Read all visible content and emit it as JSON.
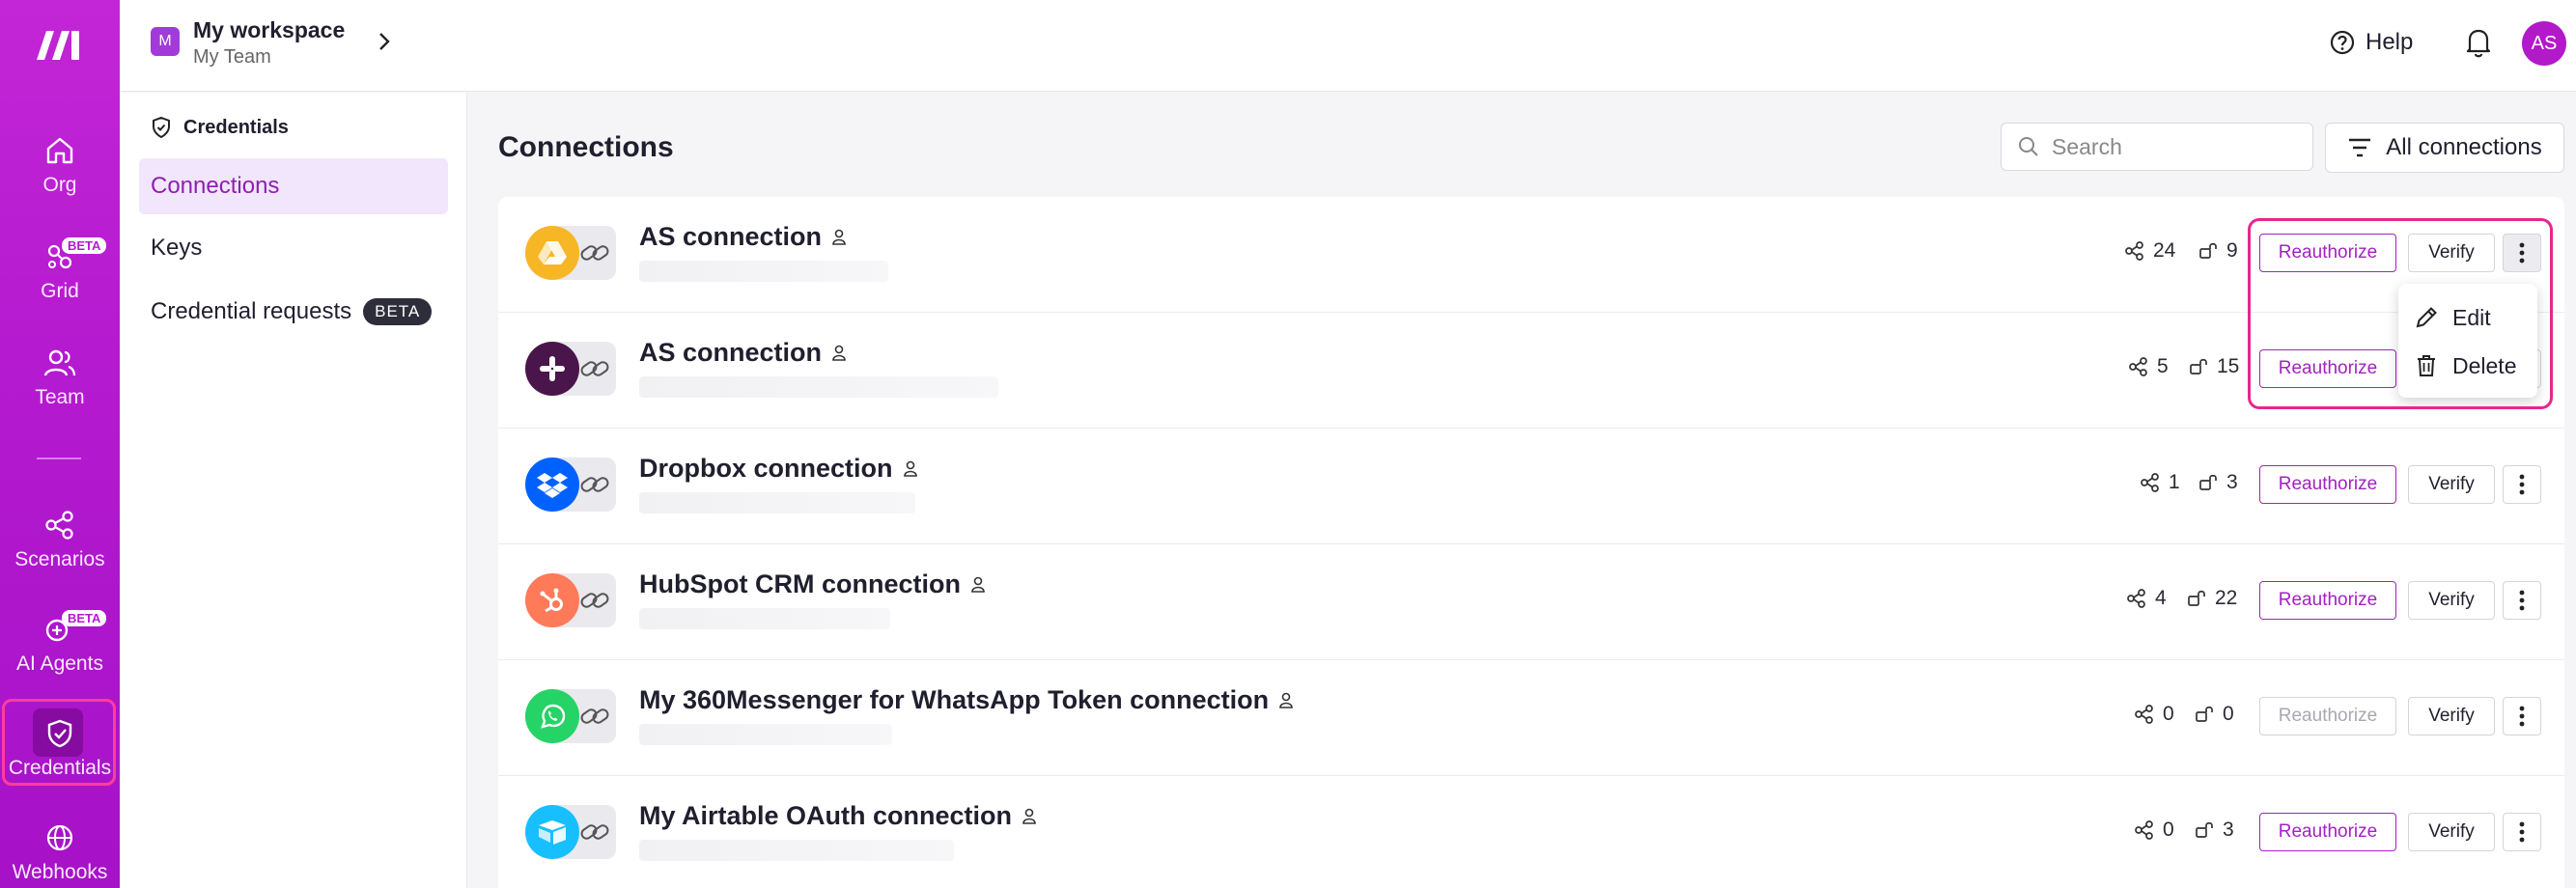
{
  "rail": {
    "items": [
      {
        "label": "Org",
        "icon": "home-icon"
      },
      {
        "label": "Grid",
        "icon": "grid-icon",
        "badge": "BETA"
      },
      {
        "label": "Team",
        "icon": "team-icon"
      },
      {
        "label": "Scenarios",
        "icon": "share-icon"
      },
      {
        "label": "AI Agents",
        "icon": "ai-agents-icon",
        "badge": "BETA"
      },
      {
        "label": "Credentials",
        "icon": "shield-icon"
      },
      {
        "label": "Webhooks",
        "icon": "globe-icon"
      }
    ]
  },
  "topbar": {
    "workspace_badge": "M",
    "workspace_name": "My workspace",
    "team_name": "My Team",
    "help_label": "Help",
    "avatar_initials": "AS"
  },
  "subnav": {
    "heading": "Credentials",
    "items": [
      {
        "label": "Connections"
      },
      {
        "label": "Keys"
      },
      {
        "label": "Credential requests",
        "badge": "BETA"
      }
    ]
  },
  "main": {
    "title": "Connections",
    "search_placeholder": "Search",
    "filter_label": "All connections",
    "reauthorize_label": "Reauthorize",
    "verify_label": "Verify",
    "rows": [
      {
        "name": "AS connection",
        "app": "google-drive",
        "color": "#f7b626",
        "scenarios": "24",
        "modules": "9"
      },
      {
        "name": "AS connection",
        "app": "slack",
        "color": "#4a154b",
        "scenarios": "5",
        "modules": "15"
      },
      {
        "name": "Dropbox connection",
        "app": "dropbox",
        "color": "#0061fe",
        "scenarios": "1",
        "modules": "3"
      },
      {
        "name": "HubSpot CRM connection",
        "app": "hubspot",
        "color": "#ff7a59",
        "scenarios": "4",
        "modules": "22"
      },
      {
        "name": "My 360Messenger for WhatsApp Token connection",
        "app": "whatsapp",
        "color": "#25d366",
        "scenarios": "0",
        "modules": "0"
      },
      {
        "name": "My Airtable OAuth connection",
        "app": "airtable",
        "color": "#18bfff",
        "scenarios": "0",
        "modules": "3"
      }
    ]
  },
  "context_menu": {
    "edit_label": "Edit",
    "delete_label": "Delete"
  },
  "colors": {
    "brand": "#b51ad0",
    "accent": "#a222bf",
    "highlight": "#e7268f"
  }
}
